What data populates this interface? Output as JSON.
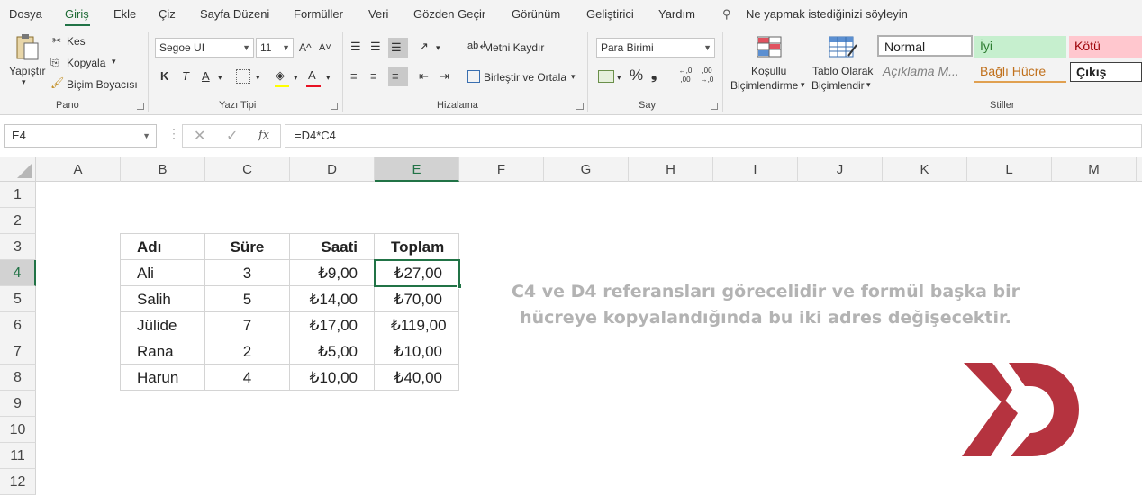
{
  "tabs": [
    "Dosya",
    "Giriş",
    "Ekle",
    "Çiz",
    "Sayfa Düzeni",
    "Formüller",
    "Veri",
    "Gözden Geçir",
    "Görünüm",
    "Geliştirici",
    "Yardım"
  ],
  "tell_me": "Ne yapmak istediğinizi söyleyin",
  "ribbon": {
    "clipboard": {
      "paste": "Yapıştır",
      "cut": "Kes",
      "copy": "Kopyala",
      "painter": "Biçim Boyacısı",
      "label": "Pano"
    },
    "font": {
      "name": "Segoe UI",
      "size": "11",
      "bold": "K",
      "italic": "T",
      "underline": "A",
      "grow": "A^",
      "shrink": "A˅",
      "label": "Yazı Tipi"
    },
    "alignment": {
      "wrap": "Metni Kaydır",
      "merge": "Birleştir ve Ortala",
      "label": "Hizalama"
    },
    "number": {
      "format": "Para Birimi",
      "percent": "%",
      "comma": "❟",
      "inc": "←,0 ,00",
      "dec": ",00 →,0",
      "label": "Sayı"
    },
    "styles": {
      "cond_line1": "Koşullu",
      "cond_line2": "Biçimlendirme",
      "table_line1": "Tablo Olarak",
      "table_line2": "Biçimlendir",
      "normal": "Normal",
      "good": "İyi",
      "bad": "Kötü",
      "explanation": "Açıklama M...",
      "linked": "Bağlı Hücre",
      "output": "Çıkış",
      "label": "Stiller"
    }
  },
  "formula_bar": {
    "name_box": "E4",
    "formula": "=D4*C4",
    "fx": "fx"
  },
  "columns": [
    "A",
    "B",
    "C",
    "D",
    "E",
    "F",
    "G",
    "H",
    "I",
    "J",
    "K",
    "L",
    "M"
  ],
  "selected_column": "E",
  "rows": [
    "1",
    "2",
    "3",
    "4",
    "5",
    "6",
    "7",
    "8",
    "9",
    "10",
    "11",
    "12"
  ],
  "selected_row": "4",
  "table": {
    "headers": [
      "Adı",
      "Süre",
      "Saati",
      "Toplam"
    ],
    "data": [
      [
        "Ali",
        "3",
        "₺9,00",
        "₺27,00"
      ],
      [
        "Salih",
        "5",
        "₺14,00",
        "₺70,00"
      ],
      [
        "Jülide",
        "7",
        "₺17,00",
        "₺119,00"
      ],
      [
        "Rana",
        "2",
        "₺5,00",
        "₺10,00"
      ],
      [
        "Harun",
        "4",
        "₺10,00",
        "₺40,00"
      ]
    ]
  },
  "note": "C4 ve D4 referansları görecelidir ve formül başka bir hücreye kopyalandığında bu iki adres değişecektir.",
  "colors": {
    "accent": "#217346",
    "logo": "#b5333f",
    "note": "#b3b3b3"
  }
}
